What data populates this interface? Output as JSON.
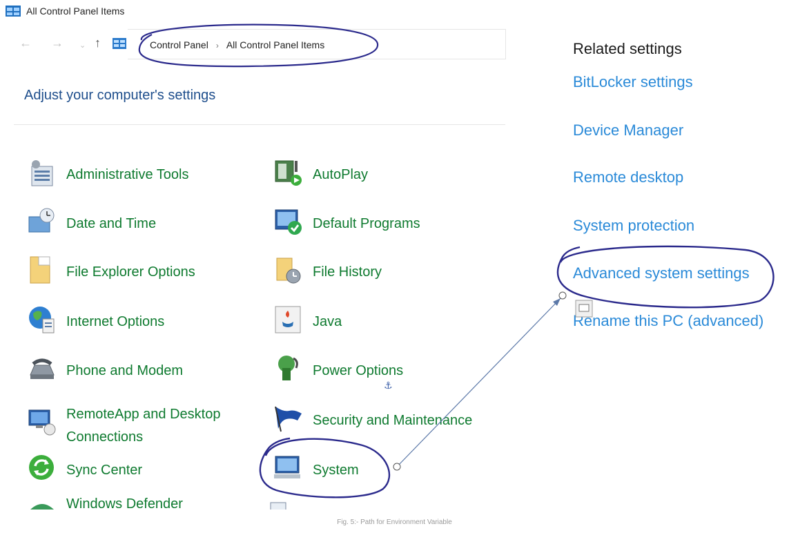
{
  "window": {
    "title": "All Control Panel Items"
  },
  "nav": {
    "back_icon": "arrow-left-icon",
    "forward_icon": "arrow-right-icon",
    "recent_icon": "chevron-down-icon",
    "up_icon": "arrow-up-icon",
    "up_glyph": "↑"
  },
  "breadcrumb": {
    "items": [
      "Control Panel",
      "All Control Panel Items"
    ],
    "separator": "›"
  },
  "page_heading": "Adjust your computer's settings",
  "items_left": [
    {
      "label": "Administrative Tools",
      "icon": "admin-tools-icon"
    },
    {
      "label": "Date and Time",
      "icon": "clock-icon"
    },
    {
      "label": "File Explorer Options",
      "icon": "folder-options-icon"
    },
    {
      "label": "Internet Options",
      "icon": "globe-icon"
    },
    {
      "label": "Phone and Modem",
      "icon": "phone-icon"
    },
    {
      "label": "RemoteApp and Desktop Connections",
      "icon": "remote-desktop-icon"
    },
    {
      "label": "Sync Center",
      "icon": "sync-icon"
    },
    {
      "label": "Windows Defender",
      "icon": "defender-icon"
    }
  ],
  "items_right": [
    {
      "label": "AutoPlay",
      "icon": "autoplay-icon"
    },
    {
      "label": "Default Programs",
      "icon": "default-programs-icon"
    },
    {
      "label": "File History",
      "icon": "file-history-icon"
    },
    {
      "label": "Java",
      "icon": "java-icon"
    },
    {
      "label": "Power Options",
      "icon": "power-icon"
    },
    {
      "label": "Security and Maintenance",
      "icon": "flag-icon"
    },
    {
      "label": "System",
      "icon": "computer-icon"
    }
  ],
  "related": {
    "heading": "Related settings",
    "links": [
      "BitLocker settings",
      "Device Manager",
      "Remote desktop",
      "System protection",
      "Advanced system settings",
      "Rename this PC (advanced)"
    ]
  },
  "anchor_glyph": "⚓",
  "caption": "Fig. 5:- Path for Environment Variable",
  "colors": {
    "item_text": "#0e7a2f",
    "heading_blue": "#1e4e8c",
    "link_blue": "#2a8ad8",
    "annotation_ink": "#2b2a8c",
    "arrow": "#5b78a8"
  }
}
